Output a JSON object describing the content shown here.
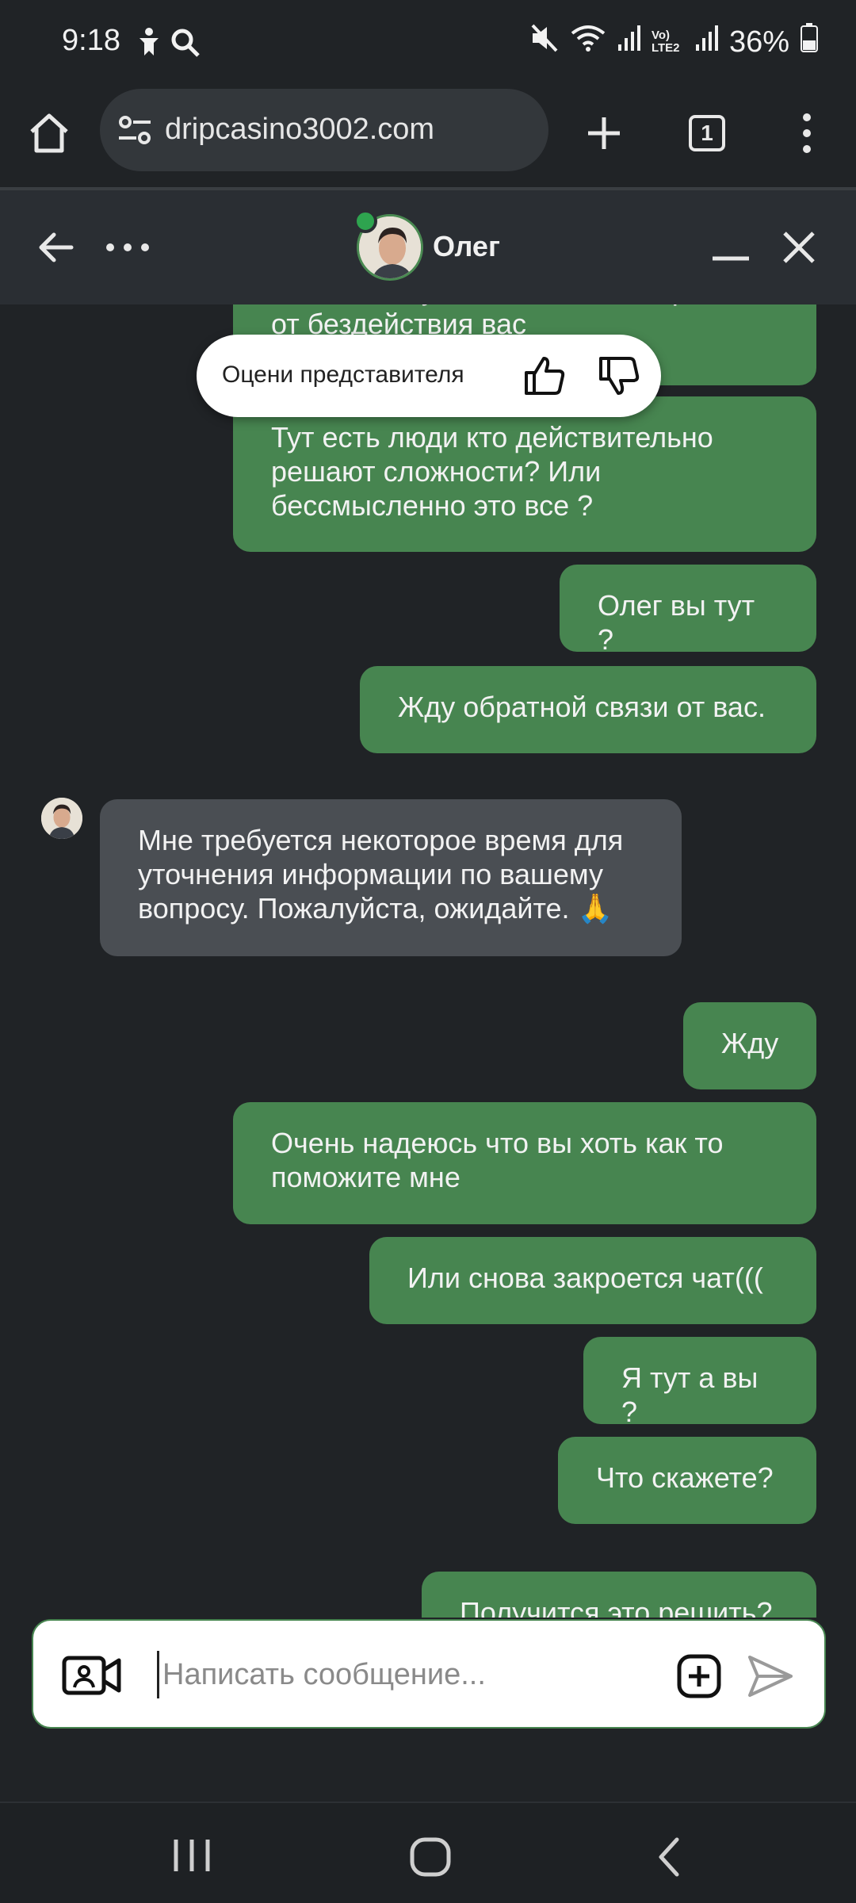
{
  "status_bar": {
    "time": "9:18",
    "battery": "36%",
    "network_label": "Vo) LTE2"
  },
  "browser": {
    "url": "dripcasino3002.com",
    "tab_count": "1",
    "icons": [
      "home-icon",
      "site-settings-icon",
      "new-tab-icon",
      "tab-switcher-icon",
      "menu-icon"
    ]
  },
  "chat_header": {
    "agent_name": "Олег",
    "icons": [
      "back-arrow-icon",
      "more-icon",
      "minimize-icon",
      "close-icon"
    ]
  },
  "rating": {
    "label": "Оцени представителя"
  },
  "messages": [
    {
      "side": "out",
      "text": "Олег я пишу что бы чат не закрылся от бездействия вас"
    },
    {
      "side": "out",
      "text": "Тут есть люди кто действительно решают сложности? Или бессмысленно это все ?"
    },
    {
      "side": "out",
      "text": "Олег вы тут ?"
    },
    {
      "side": "out",
      "text": "Жду обратной связи от вас."
    },
    {
      "side": "in",
      "text": "Мне требуется некоторое время для уточнения информации по вашему вопросу. Пожалуйста, ожидайте. 🙏"
    },
    {
      "side": "out",
      "text": "Жду"
    },
    {
      "side": "out",
      "text": "Очень надеюсь что вы хоть как то поможите мне"
    },
    {
      "side": "out",
      "text": "Или снова закроется чат((("
    },
    {
      "side": "out",
      "text": "Я тут а вы ?"
    },
    {
      "side": "out",
      "text": "Что скажете?"
    },
    {
      "side": "out",
      "text": "Получится это решить?"
    }
  ],
  "composer": {
    "placeholder": "Написать сообщение..."
  },
  "colors": {
    "outgoing_bubble": "#478550",
    "incoming_bubble": "#4a4e53",
    "background": "#202326",
    "header": "#2a2e33"
  }
}
